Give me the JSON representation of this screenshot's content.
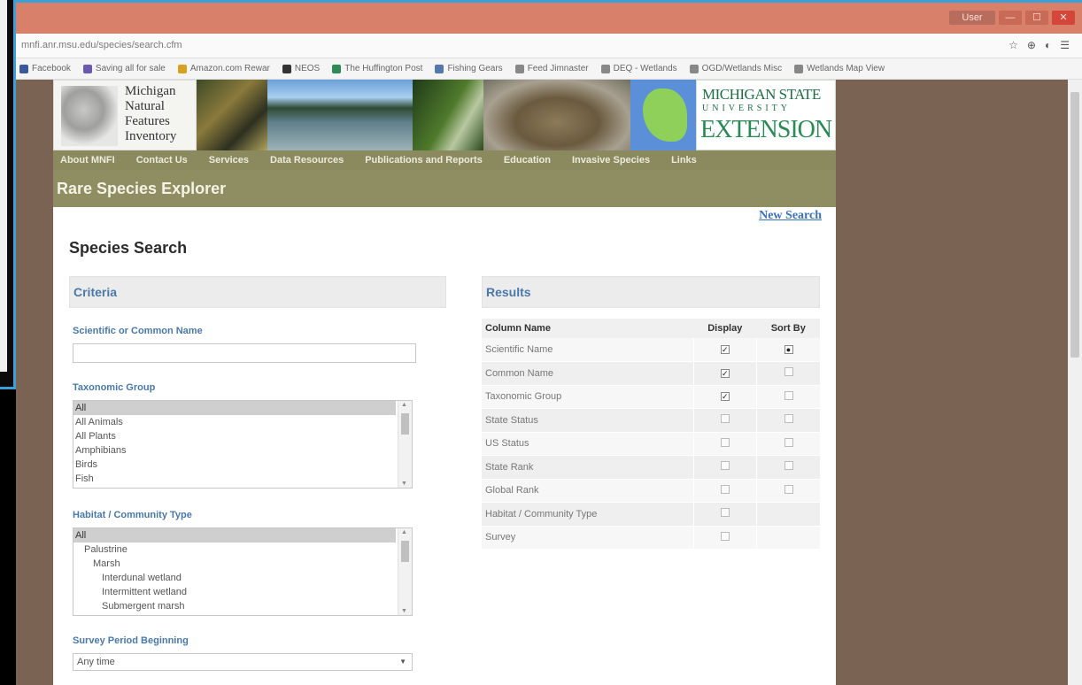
{
  "browser": {
    "url": "mnfi.anr.msu.edu/species/search.cfm",
    "window_controls": [
      "—",
      "☐",
      "✕"
    ],
    "user_label": "User",
    "address_icons": [
      "☆",
      "⊕",
      "◐",
      "☰"
    ],
    "bookmarks": [
      {
        "label": "Facebook",
        "icon_color": "#3b5998"
      },
      {
        "label": "Saving all for sale",
        "icon_color": "#6b5bb0"
      },
      {
        "label": "Amazon.com Rewar",
        "icon_color": "#d9a020"
      },
      {
        "label": "NEOS",
        "icon_color": "#333333"
      },
      {
        "label": "The Huffington Post",
        "icon_color": "#2e8b57"
      },
      {
        "label": "Fishing Gears",
        "icon_color": "#5577aa"
      },
      {
        "label": "Feed Jimnaster",
        "icon_color": "#888888"
      },
      {
        "label": "DEQ - Wetlands",
        "icon_color": "#888888"
      },
      {
        "label": "OGD/Wetlands Misc",
        "icon_color": "#888888"
      },
      {
        "label": "Wetlands Map View",
        "icon_color": "#888888"
      }
    ]
  },
  "banner": {
    "nnfi_lines": [
      "Michigan",
      "Natural",
      "Features",
      "Inventory"
    ],
    "msu_line1": "MICHIGAN STATE",
    "msu_line2": "UNIVERSITY",
    "msu_line3": "EXTENSION"
  },
  "nav": [
    "About MNFI",
    "Contact Us",
    "Services",
    "Data Resources",
    "Publications and Reports",
    "Education",
    "Invasive Species",
    "Links"
  ],
  "page_header": "Rare Species Explorer",
  "new_search": "New Search",
  "species_search_title": "Species Search",
  "criteria": {
    "title": "Criteria",
    "name_label": "Scientific or Common Name",
    "name_value": "",
    "taxonomic_label": "Taxonomic Group",
    "taxonomic_options": [
      "All",
      "All Animals",
      "All Plants",
      "Amphibians",
      "Birds",
      "Fish"
    ],
    "taxonomic_selected": 0,
    "habitat_label": "Habitat / Community Type",
    "habitat_options": [
      "All",
      "Palustrine",
      "Marsh",
      "Interdunal wetland",
      "Intermittent wetland",
      "Submergent marsh"
    ],
    "habitat_indents": [
      0,
      1,
      2,
      3,
      3,
      3
    ],
    "habitat_selected": 0,
    "survey_label": "Survey Period Beginning",
    "survey_value": "Any time"
  },
  "results": {
    "title": "Results",
    "columns": [
      "Column Name",
      "Display",
      "Sort By"
    ],
    "rows": [
      {
        "name": "Scientific Name",
        "display": true,
        "sort": true,
        "has_sort": true
      },
      {
        "name": "Common Name",
        "display": true,
        "sort": false,
        "has_sort": true
      },
      {
        "name": "Taxonomic Group",
        "display": true,
        "sort": false,
        "has_sort": true
      },
      {
        "name": "State Status",
        "display": false,
        "sort": false,
        "has_sort": true
      },
      {
        "name": "US Status",
        "display": false,
        "sort": false,
        "has_sort": true
      },
      {
        "name": "State Rank",
        "display": false,
        "sort": false,
        "has_sort": true
      },
      {
        "name": "Global Rank",
        "display": false,
        "sort": false,
        "has_sort": true
      },
      {
        "name": "Habitat / Community Type",
        "display": false,
        "sort": false,
        "has_sort": false
      },
      {
        "name": "Survey",
        "display": false,
        "sort": false,
        "has_sort": false
      }
    ]
  },
  "colors": {
    "title_bar": "#d9806a",
    "nav_bar": "#8b8a5e",
    "page_bg": "#7a6352",
    "link_blue": "#3a72b8",
    "label_blue": "#4a79a8"
  }
}
